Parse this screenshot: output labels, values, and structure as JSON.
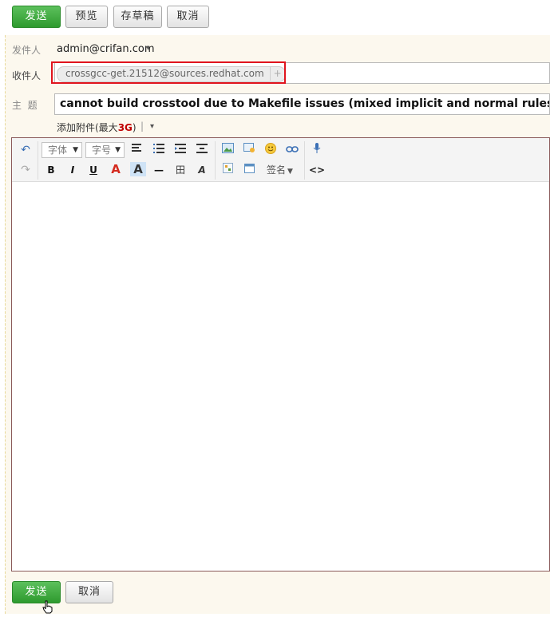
{
  "top_buttons": {
    "send": "发送",
    "preview": "预览",
    "draft": "存草稿",
    "cancel": "取消"
  },
  "from": {
    "label": "发件人",
    "value": "admin@crifan.com",
    "caret": "▾"
  },
  "to": {
    "label": "收件人",
    "recipient": "crossgcc-get.21512@sources.redhat.com",
    "add": "+"
  },
  "subject": {
    "label": "主  题",
    "value": "cannot build crosstool due to Makefile issues (mixed implicit and normal rules)"
  },
  "attach": {
    "label": "添加附件(最大",
    "size": "3G",
    "close": ")",
    "sep": "|",
    "caret": "▾"
  },
  "toolbar": {
    "font": "字体",
    "size": "字号",
    "signature": "签名",
    "bold": "B",
    "italic": "I",
    "underline": "U",
    "font_color": "A",
    "bg_color": "A",
    "source": "<>",
    "undo": "↶",
    "redo": "↷",
    "hr": "—",
    "table": "田",
    "clear": "A",
    "caret": "▾"
  },
  "bottom_buttons": {
    "send": "发送",
    "cancel": "取消"
  },
  "colors": {
    "primary_green": "#3aa83a",
    "highlight_red": "#e0141e",
    "attach_size": "#c00000"
  }
}
